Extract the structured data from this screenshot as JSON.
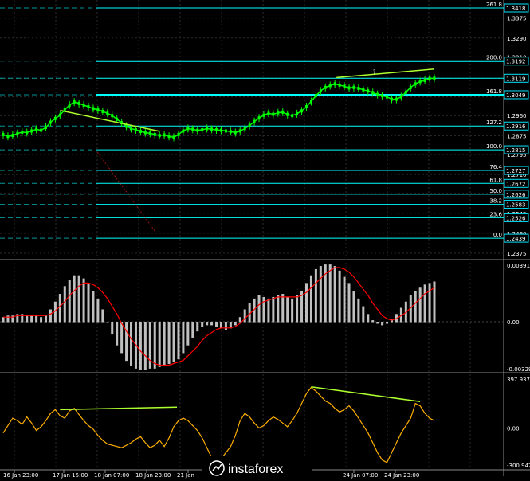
{
  "colors": {
    "background": "#000000",
    "grid": "#2b2b2b",
    "price_line": "#00ff00",
    "level_line": "#00ffff",
    "trend_line": "#adff2f",
    "hist_bar": "#c0c0c0",
    "signal_line": "#ff0000",
    "cci_line": "#ffb000"
  },
  "chart_data": [
    {
      "type": "line",
      "subtype": "candlestick-price",
      "symbol": "GBPUSD",
      "ylim": [
        1.2375,
        1.3418
      ],
      "y_ticks": [
        "1.3375",
        "1.3290",
        "1.3210",
        "1.3119",
        "1.3040",
        "1.2960",
        "1.2875",
        "1.2795",
        "1.2710",
        "1.2630",
        "1.2545",
        "1.2460",
        "1.2375"
      ],
      "fib_levels": [
        {
          "tag": "261.8",
          "price": "1.3418",
          "value": 1.3418
        },
        {
          "tag": "200.0",
          "price": "1.3192",
          "value": 1.3192
        },
        {
          "tag": "",
          "price": "1.3119",
          "value": 1.3119
        },
        {
          "tag": "161.8",
          "price": "1.3049",
          "value": 1.3049
        },
        {
          "tag": "127.2",
          "price": "1.2916",
          "value": 1.2916
        },
        {
          "tag": "100.0",
          "price": "1.2815",
          "value": 1.2815
        },
        {
          "tag": "76.4",
          "price": "1.2727",
          "value": 1.2727
        },
        {
          "tag": "61.8",
          "price": "1.2672",
          "value": 1.2672
        },
        {
          "tag": "50.0",
          "price": "1.2626",
          "value": 1.2626
        },
        {
          "tag": "38.2",
          "price": "1.2583",
          "value": 1.2583
        },
        {
          "tag": "23.6",
          "price": "1.2526",
          "value": 1.2526
        },
        {
          "tag": "0.0",
          "price": "1.2439",
          "value": 1.2439
        }
      ],
      "annotation": "?",
      "x_labels": [
        "16 Jan 23:00",
        "17 Jan 15:00",
        "18 Jan 07:00",
        "18 Jan 23:00",
        "21 Jan",
        "24 Jan 07:00",
        "24 Jan 23:00"
      ],
      "close": [
        1.288,
        1.2872,
        1.2876,
        1.2884,
        1.289,
        1.2888,
        1.2895,
        1.2902,
        1.2898,
        1.291,
        1.2932,
        1.2948,
        1.2962,
        1.2985,
        1.3005,
        1.3018,
        1.3012,
        1.3005,
        1.2998,
        1.299,
        1.2985,
        1.2978,
        1.297,
        1.296,
        1.2945,
        1.293,
        1.2915,
        1.2905,
        1.29,
        1.2893,
        1.2888,
        1.2885,
        1.288,
        1.2876,
        1.2878,
        1.2872,
        1.2868,
        1.288,
        1.2895,
        1.2905,
        1.2902,
        1.2898,
        1.29,
        1.2905,
        1.2902,
        1.29,
        1.2898,
        1.2895,
        1.2892,
        1.2888,
        1.2895,
        1.2905,
        1.2918,
        1.2935,
        1.295,
        1.2962,
        1.297,
        1.2966,
        1.2972,
        1.2975,
        1.2965,
        1.296,
        1.2968,
        1.298,
        1.2998,
        1.302,
        1.3045,
        1.3065,
        1.308,
        1.3088,
        1.3095,
        1.309,
        1.3085,
        1.3078,
        1.308,
        1.3076,
        1.307,
        1.3065,
        1.3058,
        1.305,
        1.3045,
        1.304,
        1.303,
        1.303,
        1.304,
        1.306,
        1.308,
        1.3095,
        1.3105,
        1.311,
        1.3118,
        1.3119
      ]
    },
    {
      "type": "bar",
      "subtype": "oscillator-histogram",
      "ylim": [
        -0.00329,
        0.00391
      ],
      "y_ticks": [
        "0.00391",
        "0.00",
        "-0.00329"
      ],
      "values": [
        0.0003,
        0.0004,
        0.0004,
        0.0005,
        0.0005,
        0.0004,
        0.0004,
        0.0004,
        0.0003,
        0.0004,
        0.0008,
        0.0013,
        0.0018,
        0.0023,
        0.0027,
        0.003,
        0.003,
        0.0028,
        0.0025,
        0.002,
        0.0015,
        0.0008,
        0.0,
        -0.0008,
        -0.0015,
        -0.002,
        -0.0025,
        -0.0028,
        -0.003,
        -0.0031,
        -0.0031,
        -0.003,
        -0.003,
        -0.0029,
        -0.0028,
        -0.0027,
        -0.0026,
        -0.0024,
        -0.002,
        -0.0015,
        -0.001,
        -0.0006,
        -0.0003,
        -0.0002,
        -0.0002,
        -0.0003,
        -0.0004,
        -0.0005,
        -0.0004,
        -0.0002,
        0.0003,
        0.0008,
        0.0012,
        0.0015,
        0.0017,
        0.0016,
        0.0015,
        0.0016,
        0.0017,
        0.0018,
        0.0016,
        0.0015,
        0.0017,
        0.002,
        0.0025,
        0.003,
        0.0034,
        0.0036,
        0.0037,
        0.0037,
        0.0036,
        0.0033,
        0.0029,
        0.0025,
        0.002,
        0.0015,
        0.001,
        0.0005,
        0.0001,
        -0.0001,
        -0.0002,
        -0.0001,
        0.0002,
        0.0005,
        0.0009,
        0.0013,
        0.0017,
        0.002,
        0.0022,
        0.0024,
        0.0025,
        0.0026
      ],
      "signal": [
        0.0003,
        0.0003,
        0.0003,
        0.0004,
        0.0004,
        0.0004,
        0.0004,
        0.0004,
        0.0004,
        0.0004,
        0.0005,
        0.0007,
        0.001,
        0.0013,
        0.0017,
        0.002,
        0.0023,
        0.0025,
        0.0025,
        0.0024,
        0.0022,
        0.0019,
        0.0015,
        0.001,
        0.0005,
        -0.0001,
        -0.0006,
        -0.0011,
        -0.0015,
        -0.0019,
        -0.0022,
        -0.0025,
        -0.0027,
        -0.0028,
        -0.0028,
        -0.0028,
        -0.0027,
        -0.0026,
        -0.0025,
        -0.0022,
        -0.0019,
        -0.0016,
        -0.0012,
        -0.0009,
        -0.0007,
        -0.0005,
        -0.0004,
        -0.0004,
        -0.0004,
        -0.0003,
        -0.0001,
        0.0002,
        0.0005,
        0.0008,
        0.0011,
        0.0013,
        0.0014,
        0.0015,
        0.0016,
        0.0016,
        0.0016,
        0.0016,
        0.0016,
        0.0017,
        0.0019,
        0.0022,
        0.0025,
        0.0028,
        0.0031,
        0.0033,
        0.0035,
        0.0035,
        0.0034,
        0.0032,
        0.0029,
        0.0025,
        0.0021,
        0.0017,
        0.0012,
        0.0008,
        0.0004,
        0.0002,
        0.0001,
        0.0002,
        0.0004,
        0.0006,
        0.0009,
        0.0012,
        0.0015,
        0.0018,
        0.002,
        0.0022
      ]
    },
    {
      "type": "line",
      "subtype": "oscillator",
      "ylim": [
        -300.942,
        397.9371
      ],
      "y_ticks": [
        "397.9371",
        "0.00",
        "-300.942"
      ],
      "values": [
        -40,
        20,
        80,
        60,
        30,
        90,
        40,
        -20,
        10,
        60,
        120,
        150,
        100,
        80,
        140,
        160,
        110,
        60,
        20,
        -10,
        -60,
        -100,
        -130,
        -140,
        -150,
        -160,
        -140,
        -120,
        -90,
        -70,
        -120,
        -160,
        -140,
        -100,
        -150,
        -80,
        10,
        60,
        80,
        60,
        20,
        -20,
        -80,
        -160,
        -240,
        -280,
        -250,
        -200,
        -150,
        -60,
        60,
        120,
        90,
        40,
        0,
        20,
        60,
        90,
        70,
        40,
        10,
        60,
        120,
        200,
        280,
        330,
        300,
        260,
        220,
        200,
        160,
        130,
        150,
        180,
        140,
        80,
        20,
        -40,
        -120,
        -200,
        -260,
        -280,
        -200,
        -120,
        -40,
        20,
        80,
        200,
        180,
        120,
        80,
        60
      ]
    }
  ],
  "watermark": {
    "brand": "instaforex"
  }
}
